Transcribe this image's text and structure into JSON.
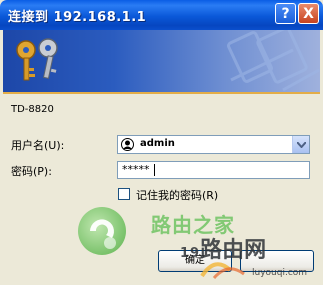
{
  "window": {
    "title": "连接到 192.168.1.1",
    "help_label": "?",
    "close_label": "X"
  },
  "banner": {
    "icon": "keys-icon"
  },
  "form": {
    "device_name": "TD-8820",
    "username_label": "用户名(U):",
    "username_value": "admin",
    "password_label": "密码(P):",
    "password_value": "*****",
    "remember_label": "记住我的密码(R)",
    "remember_checked": false,
    "ok_label": "确定"
  },
  "watermark": {
    "site_name": "路由之家",
    "brand_prefix": "19",
    "brand_name": "路由网",
    "domain": "luyouqi.com"
  },
  "colors": {
    "titlebar": "#0a58d8",
    "banner": "#2b5cbf",
    "banner_stripe": "#e3ad48",
    "window_bg": "#ece9d8",
    "watermark_green": "#77c66a"
  }
}
